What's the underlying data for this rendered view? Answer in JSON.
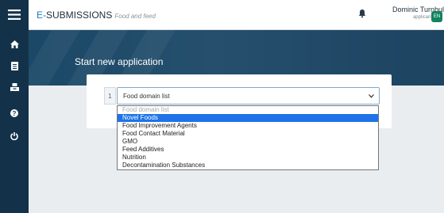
{
  "header": {
    "app_title_accent": "E-",
    "app_title": "SUBMISSIONS",
    "app_subtitle": "Food and feed",
    "user_name": "Dominic Turnbull",
    "user_role": "applicant",
    "language": "EN"
  },
  "sidebar": {
    "items": [
      {
        "icon": "home-icon"
      },
      {
        "icon": "document-icon"
      },
      {
        "icon": "inbox-icon"
      },
      {
        "icon": "help-icon"
      },
      {
        "icon": "power-icon"
      }
    ]
  },
  "main": {
    "page_title": "Start new application",
    "step_number": "1",
    "select_value": "Food domain list",
    "options": [
      {
        "label": "Food domain list",
        "state": "disabled"
      },
      {
        "label": "Novel Foods",
        "state": "selected"
      },
      {
        "label": "Food Improvement Agents",
        "state": "normal"
      },
      {
        "label": "Food Contact Material",
        "state": "normal"
      },
      {
        "label": "GMO",
        "state": "normal"
      },
      {
        "label": "Feed Additives",
        "state": "normal"
      },
      {
        "label": "Nutrition",
        "state": "normal"
      },
      {
        "label": "Decontamination Substances",
        "state": "normal"
      }
    ]
  },
  "colors": {
    "sidebar": "#13324a",
    "accent": "#1a7fc0",
    "selected_option": "#1e73e8",
    "language_badge": "#11835f"
  }
}
